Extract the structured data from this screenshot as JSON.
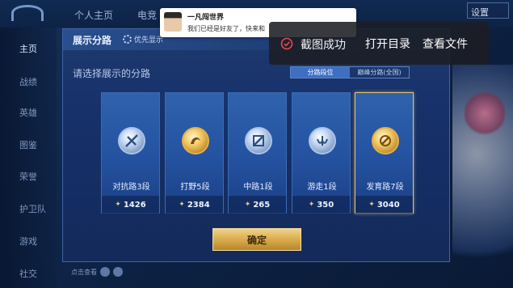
{
  "background": {
    "tabs": [
      "个人主页",
      "电竞"
    ],
    "settings_label": "设置",
    "sidebar": [
      "主页",
      "战绩",
      "英雄",
      "图鉴",
      "荣誉",
      "护卫队",
      "游戏",
      "社交"
    ],
    "bottom_strip_label": "点击查看"
  },
  "modal": {
    "title": "展示分路",
    "priority_toggle_label": "优先显示",
    "subtitle": "请选择展示的分路",
    "switch_options": [
      "分路段位",
      "巅峰分路(全国)"
    ],
    "switch_selected": "分路段位",
    "cards": [
      {
        "label": "对抗路3段",
        "points": "1426",
        "badge": "silver",
        "icon": "sword-icon",
        "selected": false
      },
      {
        "label": "打野5段",
        "points": "2384",
        "badge": "gold",
        "icon": "jungle-icon",
        "selected": false
      },
      {
        "label": "中路1段",
        "points": "265",
        "badge": "silver",
        "icon": "mid-lane-icon",
        "selected": false
      },
      {
        "label": "游走1段",
        "points": "350",
        "badge": "silver",
        "icon": "roam-icon",
        "selected": false
      },
      {
        "label": "发育路7段",
        "points": "3040",
        "badge": "gold",
        "icon": "farm-lane-icon",
        "selected": true
      }
    ],
    "confirm_label": "确定"
  },
  "friend_toast": {
    "name": "一凡闯世界",
    "message": "我们已经是好友了，快来和"
  },
  "screenshot_toast": {
    "status": "截图成功",
    "open_dir": "打开目录",
    "view_file": "查看文件",
    "accent_color": "#e84a4a"
  }
}
